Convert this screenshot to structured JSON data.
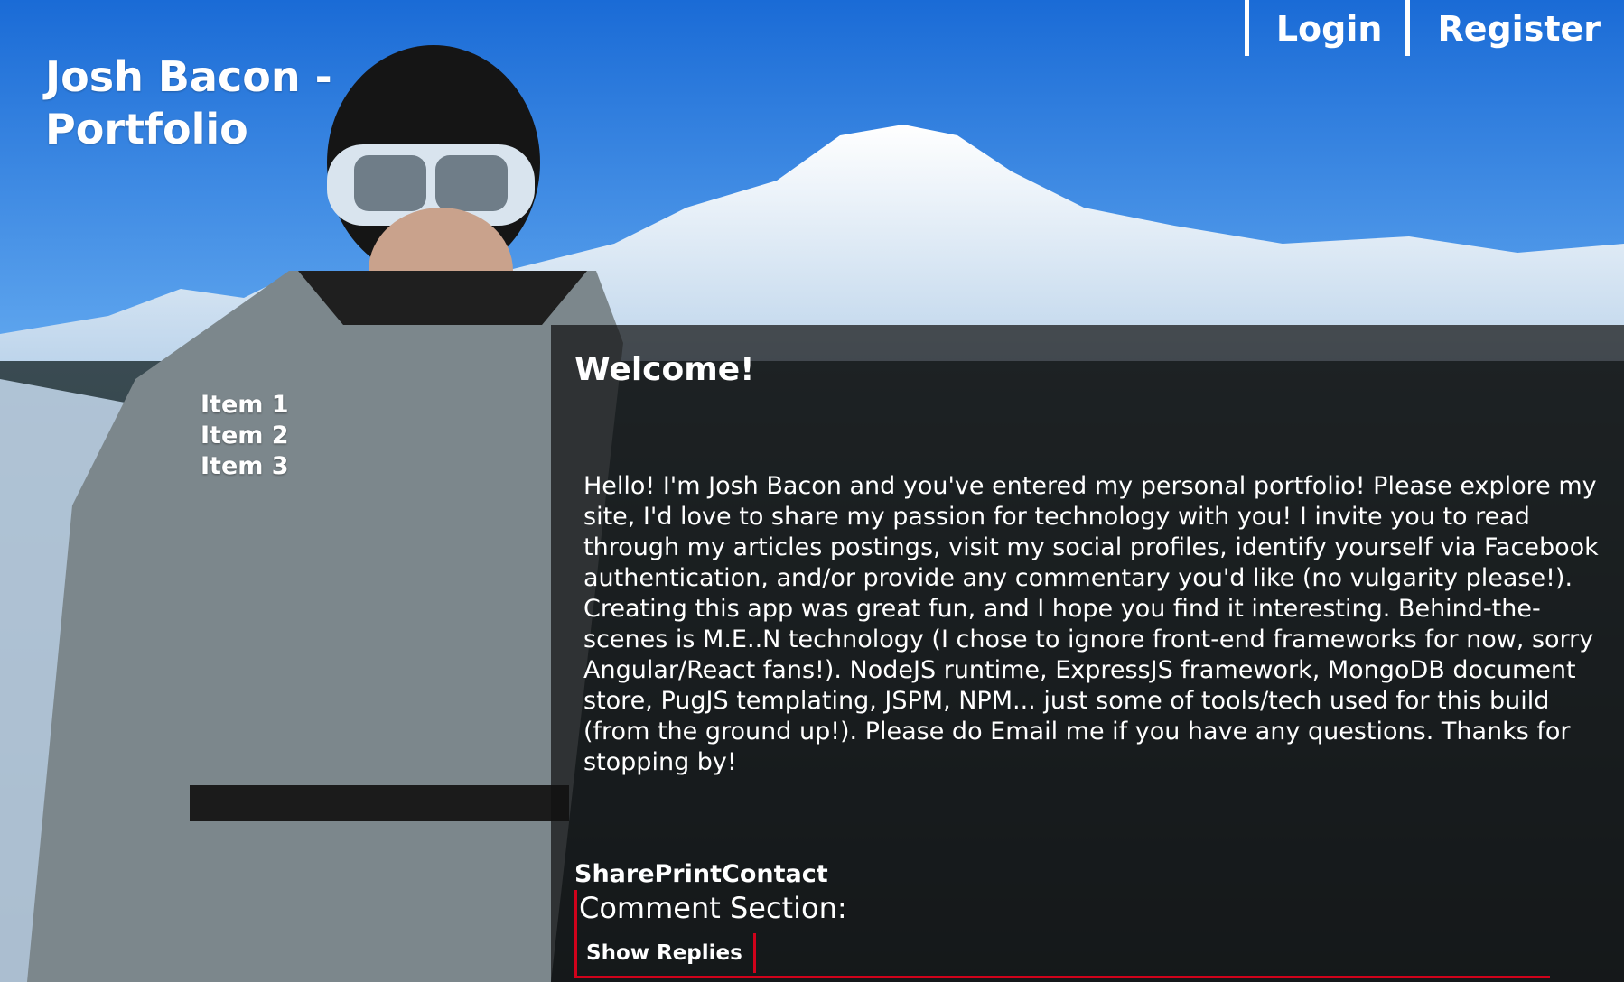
{
  "header": {
    "title": "Josh Bacon - Portfolio",
    "login_label": "Login",
    "register_label": "Register"
  },
  "side_nav": {
    "items": [
      "Item 1",
      "Item 2",
      "Item 3"
    ]
  },
  "main": {
    "heading": "Welcome!",
    "body": "Hello! I'm Josh Bacon and you've entered my personal portfolio! Please explore my site, I'd love to share my passion for technology with you! I invite you to read through my articles postings, visit my social profiles, identify yourself via Facebook authentication, and/or provide any commentary you'd like (no vulgarity please!). Creating this app was great fun, and I hope you find it interesting. Behind-the-scenes is M.E..N technology (I chose to ignore front-end frameworks for now, sorry Angular/React fans!). NodeJS runtime, ExpressJS framework, MongoDB document store, PugJS templating, JSPM, NPM... just some of tools/tech used for this build (from the ground up!). Please do Email me if you have any questions. Thanks for stopping by!",
    "actions": {
      "share_label": "Share",
      "print_label": "Print",
      "contact_label": "Contact"
    },
    "comments": {
      "heading": "Comment Section:",
      "show_replies_label": "Show Replies"
    }
  },
  "colors": {
    "accent": "#d0021b",
    "sky": "#2a7de1",
    "panel": "#121212"
  }
}
